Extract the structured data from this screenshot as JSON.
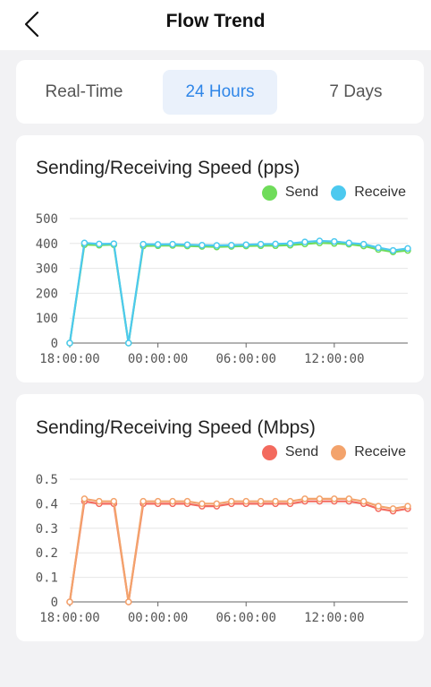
{
  "header": {
    "title": "Flow Trend",
    "back_icon": "chevron-left-icon"
  },
  "tabs": [
    {
      "label": "Real-Time",
      "active": false
    },
    {
      "label": "24 Hours",
      "active": true
    },
    {
      "label": "7 Days",
      "active": false
    }
  ],
  "colors": {
    "accent": "#2f86e8",
    "pps_send": "#6fdc5a",
    "pps_receive": "#4cc9ef",
    "mbps_send": "#f36a5e",
    "mbps_receive": "#f3a36c"
  },
  "chart_data": [
    {
      "type": "line",
      "title": "Sending/Receiving Speed (pps)",
      "x_tick_labels": [
        "18:00:00",
        "00:00:00",
        "06:00:00",
        "12:00:00"
      ],
      "ylim": [
        0,
        500
      ],
      "y_ticks": [
        "500",
        "400",
        "300",
        "200",
        "100",
        "0"
      ],
      "grid": true,
      "legend_position": "top-right",
      "series": [
        {
          "name": "Send",
          "color": "#6fdc5a",
          "values": [
            0,
            395,
            393,
            395,
            0,
            390,
            391,
            392,
            390,
            388,
            386,
            388,
            390,
            391,
            391,
            393,
            398,
            402,
            400,
            397,
            390,
            376,
            366,
            372
          ]
        },
        {
          "name": "Receive",
          "color": "#4cc9ef",
          "values": [
            0,
            402,
            398,
            399,
            0,
            397,
            396,
            397,
            395,
            393,
            392,
            393,
            395,
            397,
            398,
            400,
            406,
            410,
            408,
            402,
            397,
            383,
            372,
            380
          ]
        }
      ]
    },
    {
      "type": "line",
      "title": "Sending/Receiving Speed (Mbps)",
      "x_tick_labels": [
        "18:00:00",
        "00:00:00",
        "06:00:00",
        "12:00:00"
      ],
      "ylim": [
        0,
        0.5
      ],
      "y_ticks": [
        "0.5",
        "0.4",
        "0.3",
        "0.2",
        "0.1",
        "0"
      ],
      "grid": true,
      "legend_position": "top-right",
      "series": [
        {
          "name": "Send",
          "color": "#f36a5e",
          "values": [
            0,
            0.41,
            0.4,
            0.4,
            0,
            0.4,
            0.4,
            0.4,
            0.4,
            0.39,
            0.39,
            0.4,
            0.4,
            0.4,
            0.4,
            0.4,
            0.41,
            0.41,
            0.41,
            0.41,
            0.4,
            0.38,
            0.37,
            0.38
          ]
        },
        {
          "name": "Receive",
          "color": "#f3a36c",
          "values": [
            0,
            0.42,
            0.41,
            0.41,
            0,
            0.41,
            0.41,
            0.41,
            0.41,
            0.4,
            0.4,
            0.41,
            0.41,
            0.41,
            0.41,
            0.41,
            0.42,
            0.42,
            0.42,
            0.42,
            0.41,
            0.39,
            0.38,
            0.39
          ]
        }
      ]
    }
  ]
}
